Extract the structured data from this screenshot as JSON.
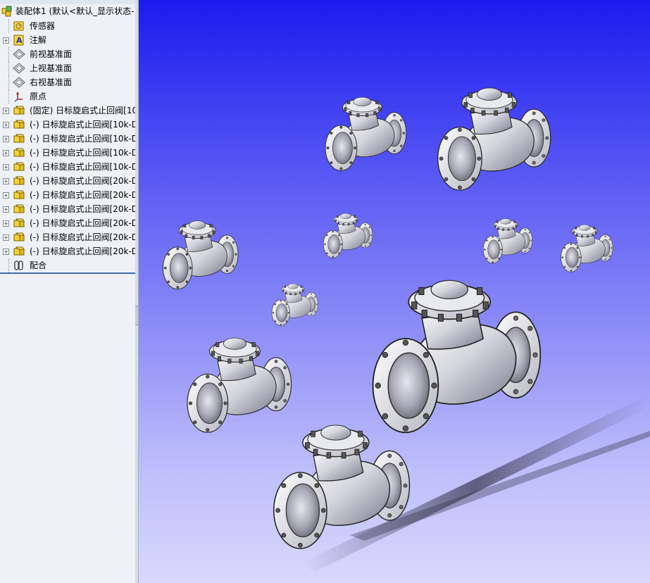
{
  "feature_tree": {
    "root": {
      "label": "装配体1  (默认<默认_显示状态-",
      "icon": "assembly-icon"
    },
    "items": [
      {
        "label": "传感器",
        "icon": "sensor-icon",
        "expandable": false
      },
      {
        "label": "注解",
        "icon": "annotation-icon",
        "expandable": true
      },
      {
        "label": "前视基准面",
        "icon": "plane-icon",
        "expandable": false
      },
      {
        "label": "上视基准面",
        "icon": "plane-icon",
        "expandable": false
      },
      {
        "label": "右视基准面",
        "icon": "plane-icon",
        "expandable": false
      },
      {
        "label": "原点",
        "icon": "origin-icon",
        "expandable": false
      },
      {
        "label": "(固定) 日标旋启式止回阀[10",
        "icon": "part-icon",
        "expandable": true
      },
      {
        "label": "(-) 日标旋启式止回阀[10k-D",
        "icon": "part-icon",
        "expandable": true
      },
      {
        "label": "(-) 日标旋启式止回阀[10k-D",
        "icon": "part-icon",
        "expandable": true
      },
      {
        "label": "(-) 日标旋启式止回阀[10k-D",
        "icon": "part-icon",
        "expandable": true
      },
      {
        "label": "(-) 日标旋启式止回阀[10k-D",
        "icon": "part-icon",
        "expandable": true
      },
      {
        "label": "(-) 日标旋启式止回阀[20k-D",
        "icon": "part-icon",
        "expandable": true
      },
      {
        "label": "(-) 日标旋启式止回阀[20k-D",
        "icon": "part-icon",
        "expandable": true
      },
      {
        "label": "(-) 日标旋启式止回阀[20k-D",
        "icon": "part-icon",
        "expandable": true
      },
      {
        "label": "(-) 日标旋启式止回阀[20k-D",
        "icon": "part-icon",
        "expandable": true
      },
      {
        "label": "(-) 日标旋启式止回阀[20k-D",
        "icon": "part-icon",
        "expandable": true
      },
      {
        "label": "(-) 日标旋启式止回阀[20k-D",
        "icon": "part-icon",
        "expandable": true
      },
      {
        "label": "配合",
        "icon": "mates-icon",
        "expandable": false
      }
    ]
  },
  "viewport": {
    "background_top": "#1b1bef",
    "background_bottom": "#d8d8fd",
    "model": "check-valve-assembly",
    "valve_count": 11
  }
}
